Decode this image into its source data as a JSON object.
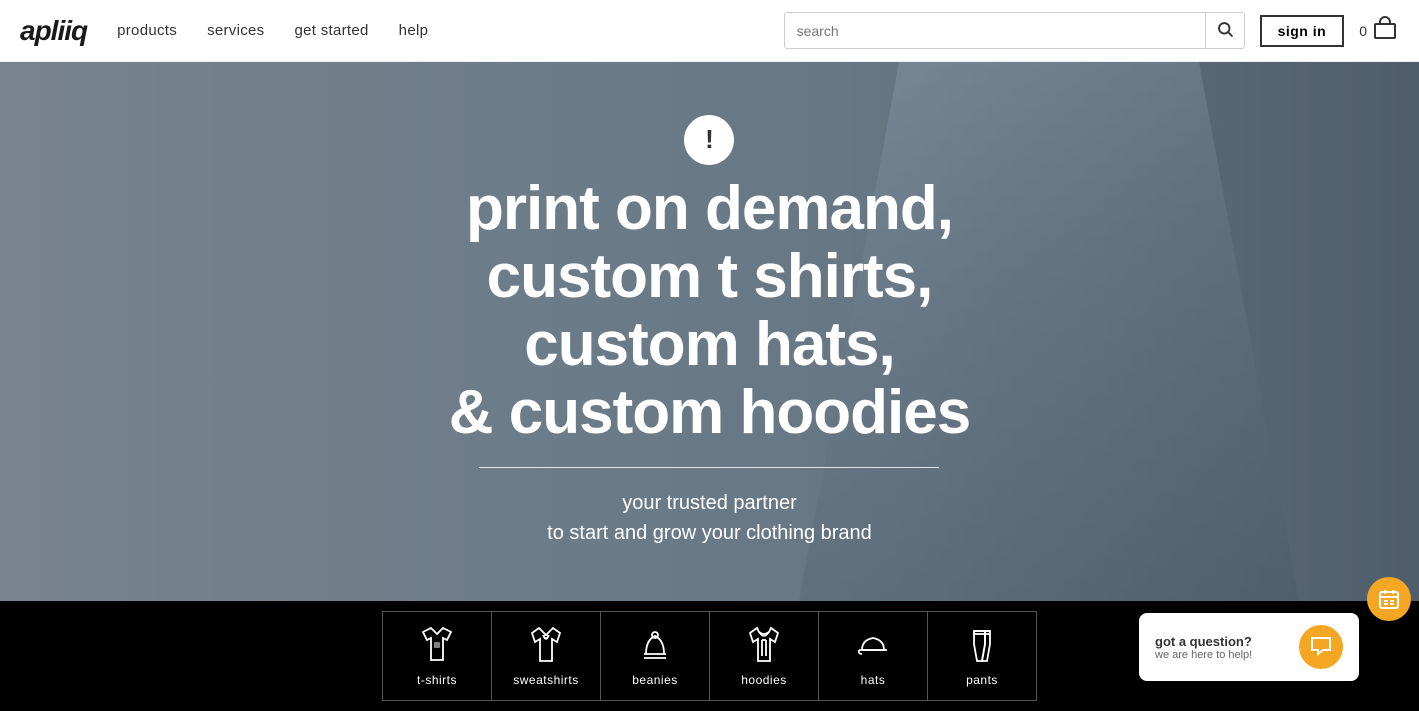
{
  "header": {
    "logo": "apliiq",
    "nav": {
      "items": [
        {
          "label": "products",
          "href": "#"
        },
        {
          "label": "services",
          "href": "#"
        },
        {
          "label": "get started",
          "href": "#"
        },
        {
          "label": "help",
          "href": "#"
        }
      ]
    },
    "search": {
      "placeholder": "search"
    },
    "sign_in_label": "sign in",
    "cart_count": "0"
  },
  "hero": {
    "alert_icon": "!",
    "title_line1": "print on demand,",
    "title_line2": "custom t shirts,",
    "title_line3": "custom hats,",
    "title_line4": "& custom hoodies",
    "subtitle_line1": "your trusted partner",
    "subtitle_line2": "to start and grow your clothing brand"
  },
  "categories": [
    {
      "label": "t-shirts",
      "icon": "tshirt"
    },
    {
      "label": "sweatshirts",
      "icon": "sweatshirt"
    },
    {
      "label": "beanies",
      "icon": "beanie"
    },
    {
      "label": "hoodies",
      "icon": "hoodie"
    },
    {
      "label": "hats",
      "icon": "hat"
    },
    {
      "label": "pants",
      "icon": "pants"
    }
  ],
  "chat": {
    "title": "got a question?",
    "subtitle": "we are here to help!"
  }
}
